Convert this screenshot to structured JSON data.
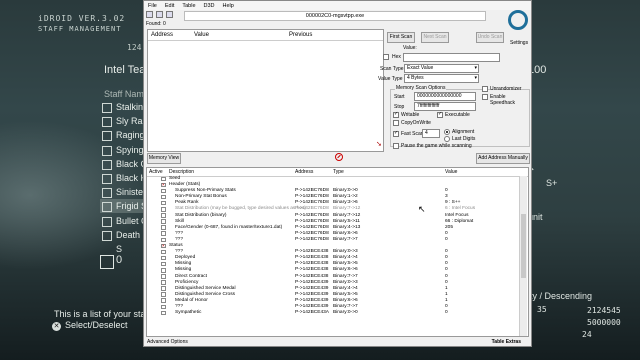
{
  "game": {
    "hud_title": "iDROID VER.3.02",
    "hud_sub": "STAFF MANAGEMENT",
    "top_num": "124",
    "section": "Intel Tea",
    "staff_name_header": "Staff Name",
    "staff": [
      {
        "name": "Stalkin",
        "checked": false,
        "selected": false
      },
      {
        "name": "Sly Ra",
        "checked": false,
        "selected": false
      },
      {
        "name": "Raging",
        "checked": false,
        "selected": false
      },
      {
        "name": "Spying",
        "checked": false,
        "selected": false
      },
      {
        "name": "Black C",
        "checked": false,
        "selected": false
      },
      {
        "name": "Black H",
        "checked": false,
        "selected": false
      },
      {
        "name": "Sinister",
        "checked": false,
        "selected": false
      },
      {
        "name": "Frigid S",
        "checked": false,
        "selected": true
      },
      {
        "name": "Bullet C",
        "checked": false,
        "selected": false
      },
      {
        "name": "Death S",
        "checked": false,
        "selected": false
      }
    ],
    "staff_count": "0",
    "hint": "This is a list of your staff",
    "select_label": "Select/Deselect",
    "right_value": "100",
    "right_s_label": "S+",
    "right_unit": "unit",
    "right_sort": "ity / Descending",
    "num_35": "35",
    "num_2124545": "2124545",
    "num_5000000": "5000000",
    "num_24": "24"
  },
  "ce": {
    "menu": [
      "File",
      "Edit",
      "Table",
      "D3D",
      "Help"
    ],
    "process_title": "000002C0-mgsvtpp.exe",
    "found": "Found: 0",
    "results_columns": [
      "Address",
      "Value",
      "Previous"
    ],
    "buttons": {
      "first_scan": "First Scan",
      "next_scan": "Next Scan",
      "undo_scan": "Undo Scan",
      "memory_view": "Memory View",
      "add_address": "Add Address Manually"
    },
    "settings_label": "Settings",
    "value_label": "Value:",
    "hex_label": "Hex",
    "scan_type_label": "Scan Type",
    "scan_type_value": "Exact Value",
    "value_type_label": "Value Type",
    "value_type_value": "4 Bytes",
    "memory_scan_options": "Memory Scan Options",
    "start_label": "Start",
    "start_value": "0000000000000000",
    "stop_label": "Stop",
    "stop_value": "7fffffffffffffff",
    "writable_label": "Writable",
    "executable_label": "Executable",
    "copyonwrite_label": "CopyOnWrite",
    "fast_scan_label": "Fast Scan",
    "fast_scan_value": "4",
    "alignment_label": "Alignment",
    "last_digits_label": "Last Digits",
    "pause_label": "Pause the game while scanning",
    "unrandomizer_label": "Unrandomizer",
    "speedhack_label": "Enable Speedhack",
    "table_columns": [
      "Active",
      "Description",
      "Address",
      "Type",
      "Value"
    ],
    "rows": [
      {
        "indent": 0,
        "active": false,
        "desc": "Seed",
        "addr": "",
        "type": "",
        "value": "",
        "dim": false
      },
      {
        "indent": 0,
        "active": true,
        "desc": "Header (Stats)",
        "addr": "",
        "type": "",
        "value": "",
        "dim": false
      },
      {
        "indent": 1,
        "active": false,
        "desc": "Suppress Non-Primary Stats",
        "addr": "P->142BC76D8",
        "type": "Binary:0->0",
        "value": "0",
        "dim": false
      },
      {
        "indent": 1,
        "active": false,
        "desc": "Non-Primary Stat Bonus",
        "addr": "P->142BC76D8",
        "type": "Binary:1->2",
        "value": "3",
        "dim": false
      },
      {
        "indent": 1,
        "active": false,
        "desc": "Peak Rank",
        "addr": "P->142BC76D8",
        "type": "Binary:3->6",
        "value": "9 : S++",
        "dim": false
      },
      {
        "indent": 1,
        "active": false,
        "desc": "Stat Distribution (may be bugged, type desired values as hex)",
        "addr": "P->142BC76D8",
        "type": "Binary:7->12",
        "value": "6 : Intel Focus",
        "dim": true
      },
      {
        "indent": 1,
        "active": false,
        "desc": "Stat Distribution (binary)",
        "addr": "P->142BC76D8",
        "type": "Binary:7->12",
        "value": "Intel Focus",
        "dim": false
      },
      {
        "indent": 1,
        "active": false,
        "desc": "Skill",
        "addr": "P->142BC76D8",
        "type": "Binary:5->11",
        "value": "66 : Diplomat",
        "dim": false
      },
      {
        "indent": 1,
        "active": false,
        "desc": "Face/Gender (0-687, found in master/texture1.dat)",
        "addr": "P->142BC76D8",
        "type": "Binary:4->13",
        "value": "205",
        "dim": false
      },
      {
        "indent": 1,
        "active": false,
        "desc": "???",
        "addr": "P->142BC76D8",
        "type": "Binary:6->6",
        "value": "0",
        "dim": false
      },
      {
        "indent": 1,
        "active": false,
        "desc": "???",
        "addr": "P->142BC76D8",
        "type": "Binary:7->7",
        "value": "0",
        "dim": false
      },
      {
        "indent": 0,
        "active": true,
        "desc": "Status",
        "addr": "",
        "type": "",
        "value": "",
        "dim": false
      },
      {
        "indent": 1,
        "active": false,
        "desc": "???",
        "addr": "P->142BCE438",
        "type": "Binary:0->3",
        "value": "0",
        "dim": false
      },
      {
        "indent": 1,
        "active": false,
        "desc": "Deployed",
        "addr": "P->142BCE438",
        "type": "Binary:4->4",
        "value": "0",
        "dim": false
      },
      {
        "indent": 1,
        "active": false,
        "desc": "Missing",
        "addr": "P->142BCE438",
        "type": "Binary:5->5",
        "value": "0",
        "dim": false
      },
      {
        "indent": 1,
        "active": false,
        "desc": "Missing",
        "addr": "P->142BCE438",
        "type": "Binary:6->6",
        "value": "0",
        "dim": false
      },
      {
        "indent": 1,
        "active": false,
        "desc": "Direct Contract",
        "addr": "P->142BCE438",
        "type": "Binary:7->7",
        "value": "0",
        "dim": false
      },
      {
        "indent": 1,
        "active": false,
        "desc": "Proficiency",
        "addr": "P->142BCE439",
        "type": "Binary:0->3",
        "value": "0",
        "dim": false
      },
      {
        "indent": 1,
        "active": false,
        "desc": "Distinguished Service Medal",
        "addr": "P->142BCE439",
        "type": "Binary:4->4",
        "value": "1",
        "dim": false
      },
      {
        "indent": 1,
        "active": false,
        "desc": "Distinguished Service Cross",
        "addr": "P->142BCE439",
        "type": "Binary:5->5",
        "value": "1",
        "dim": false
      },
      {
        "indent": 1,
        "active": false,
        "desc": "Medal of Honor",
        "addr": "P->142BCE439",
        "type": "Binary:6->6",
        "value": "1",
        "dim": false
      },
      {
        "indent": 1,
        "active": false,
        "desc": "???",
        "addr": "P->142BCE439",
        "type": "Binary:7->7",
        "value": "0",
        "dim": false
      },
      {
        "indent": 1,
        "active": false,
        "desc": "Sympathetic",
        "addr": "P->142BCE43A",
        "type": "Binary:0->0",
        "value": "0",
        "dim": false
      }
    ],
    "advanced_options": "Advanced Options",
    "table_extras": "Table Extras"
  }
}
